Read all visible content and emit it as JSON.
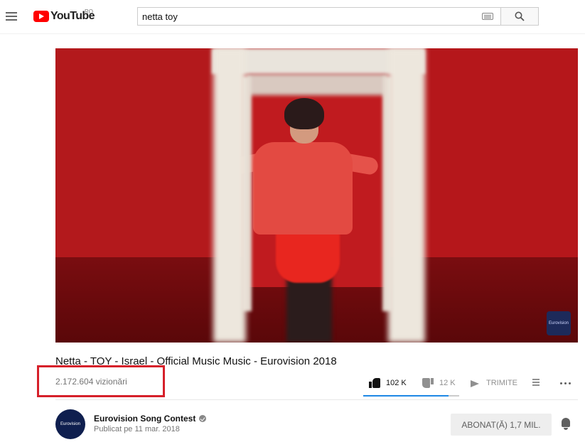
{
  "header": {
    "logo_text": "YouTube",
    "region": "RO",
    "icons": {
      "menu": "hamburger-icon",
      "keyboard": "keyboard-icon",
      "search": "search-icon"
    }
  },
  "search": {
    "value": "netta toy"
  },
  "video": {
    "title": "Netta - TOY - Israel - Official Music Music - Eurovision 2018",
    "views": "2.172.604 vizionări",
    "watermark": "Eurovision"
  },
  "actions": {
    "likes": "102 K",
    "dislikes": "12 K",
    "share": "TRIMITE",
    "like_ratio": 0.89,
    "colors": {
      "active": "#1e88e5",
      "inactive": "#909090",
      "highlight": "#d6202a"
    }
  },
  "channel": {
    "name": "Eurovision Song Contest",
    "avatar_text": "Eurovision",
    "published": "Publicat pe 11 mar. 2018",
    "subscribe_label": "ABONAT(Ă)   1,7 MIL."
  }
}
